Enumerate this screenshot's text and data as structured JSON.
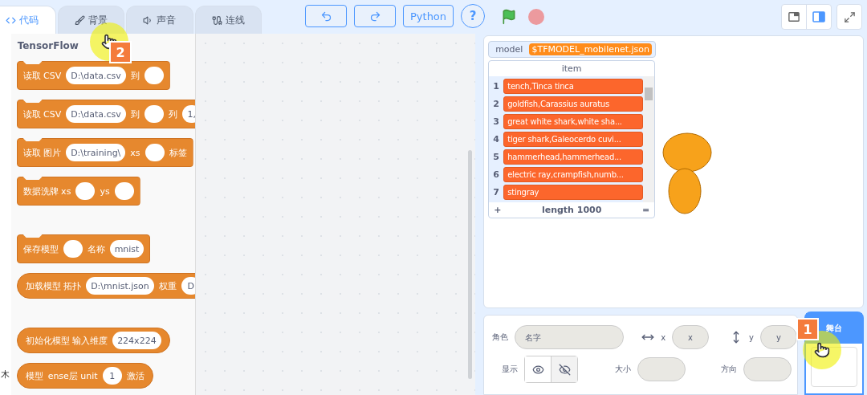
{
  "tabs": [
    {
      "label": "代码",
      "kind": "code",
      "selected": true
    },
    {
      "label": "背景",
      "kind": "brush",
      "selected": false
    },
    {
      "label": "声音",
      "kind": "sound",
      "selected": false
    },
    {
      "label": "连线",
      "kind": "link",
      "selected": false
    }
  ],
  "toolbar": [
    {
      "kind": "undo"
    },
    {
      "kind": "redo"
    },
    {
      "kind": "text",
      "label": "Python"
    },
    {
      "kind": "help",
      "label": "?"
    }
  ],
  "controls": [
    {
      "kind": "flag"
    },
    {
      "kind": "stop"
    }
  ],
  "view_buttons": [
    {
      "kind": "small",
      "selected": false
    },
    {
      "kind": "large",
      "selected": true
    },
    {
      "kind": "fullscreen",
      "selected": false
    }
  ],
  "category_strip": {
    "label": "木"
  },
  "palette": {
    "title": "TensorFlow",
    "blocks": [
      {
        "kind": "stack",
        "parts": [
          {
            "kind": "text",
            "text": "读取 CSV"
          },
          {
            "kind": "input",
            "text": "D:\\data.csv"
          },
          {
            "kind": "text",
            "text": "到"
          },
          {
            "kind": "input"
          }
        ]
      },
      {
        "kind": "stack",
        "parts": [
          {
            "kind": "text",
            "text": "读取 CSV"
          },
          {
            "kind": "input",
            "text": "D:\\data.csv"
          },
          {
            "kind": "text",
            "text": "到"
          },
          {
            "kind": "input"
          },
          {
            "kind": "text",
            "text": "列"
          },
          {
            "kind": "input",
            "text": "1,"
          }
        ]
      },
      {
        "kind": "stack",
        "parts": [
          {
            "kind": "text",
            "text": "读取 图片"
          },
          {
            "kind": "input",
            "text": "D:\\training\\"
          },
          {
            "kind": "text",
            "text": "xs"
          },
          {
            "kind": "input"
          },
          {
            "kind": "text",
            "text": "标签"
          }
        ]
      },
      {
        "kind": "stack",
        "parts": [
          {
            "kind": "text",
            "text": "数据洗牌 xs"
          },
          {
            "kind": "input"
          },
          {
            "kind": "text",
            "text": "ys"
          },
          {
            "kind": "input"
          }
        ]
      },
      {
        "kind": "gap"
      },
      {
        "kind": "stack",
        "parts": [
          {
            "kind": "text",
            "text": "保存模型"
          },
          {
            "kind": "input"
          },
          {
            "kind": "text",
            "text": "名称"
          },
          {
            "kind": "input",
            "text": "mnist"
          }
        ]
      },
      {
        "kind": "reporter",
        "parts": [
          {
            "kind": "text",
            "text": "加载模型 拓扑"
          },
          {
            "kind": "input",
            "text": "D:\\mnist.json"
          },
          {
            "kind": "text",
            "text": "权重"
          },
          {
            "kind": "input",
            "text": "D"
          }
        ]
      },
      {
        "kind": "gap"
      },
      {
        "kind": "reporter",
        "parts": [
          {
            "kind": "text",
            "text": "初始化模型 输入维度"
          },
          {
            "kind": "input",
            "text": "224x224"
          }
        ]
      },
      {
        "kind": "reporter",
        "parts": [
          {
            "kind": "text",
            "text": "模型"
          },
          {
            "kind": "text",
            "text": "ense层 unit"
          },
          {
            "kind": "input",
            "text": "1"
          },
          {
            "kind": "text",
            "text": "激活"
          }
        ]
      }
    ]
  },
  "stage": {
    "variable": {
      "name": "model",
      "value": "$TFMODEL_mobilenet.json"
    },
    "list": {
      "header": "item",
      "rows": [
        {
          "index": "1",
          "value": "tench,Tinca tinca"
        },
        {
          "index": "2",
          "value": "goldfish,Carassius auratus"
        },
        {
          "index": "3",
          "value": "great white shark,white sha..."
        },
        {
          "index": "4",
          "value": "tiger shark,Galeocerdo cuvi..."
        },
        {
          "index": "5",
          "value": "hammerhead,hammerhead..."
        },
        {
          "index": "6",
          "value": "electric ray,crampfish,numb..."
        },
        {
          "index": "7",
          "value": "stingray"
        }
      ],
      "add": "+",
      "length": "length 1000",
      "resize": "="
    }
  },
  "sprite_info": {
    "sprite_label": "角色",
    "name_placeholder": "名字",
    "x_label": "x",
    "x_placeholder": "x",
    "y_label": "y",
    "y_placeholder": "y",
    "show_label": "显示",
    "visible": true,
    "size_label": "大小",
    "direction_label": "方向"
  },
  "stage_panel": {
    "title": "舞台"
  },
  "annotations": [
    {
      "label": "2"
    },
    {
      "label": "1"
    }
  ]
}
